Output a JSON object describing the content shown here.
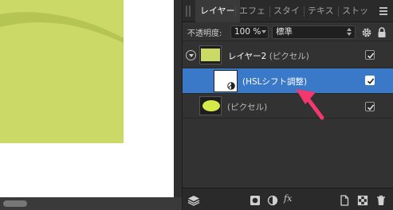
{
  "tabs": [
    {
      "label": "レイヤー",
      "active": true
    },
    {
      "label": "エフェ"
    },
    {
      "label": "スタイ"
    },
    {
      "label": "テキス"
    },
    {
      "label": "ストッ"
    }
  ],
  "opacity": {
    "label": "不透明度:",
    "value": "100 %"
  },
  "blend_mode": {
    "value": "標準"
  },
  "layers": [
    {
      "name": "レイヤー2",
      "type": " (ピクセル)",
      "visible": true,
      "expanded": true
    },
    {
      "name": "(HSLシフト調整)",
      "visible": true,
      "selected": true
    },
    {
      "name": "(ピクセル)",
      "visible": true
    }
  ],
  "icons": {
    "panel_menu": "hamburger-icon",
    "settings": "gear-icon",
    "lock": "lock-icon",
    "bottom": [
      "layers-stack-icon",
      "mask-icon",
      "adjustment-icon",
      "fx-icon",
      "new-document-icon",
      "grid-icon",
      "trash-icon"
    ]
  },
  "bottom_bar": {
    "fx_label": "fx"
  },
  "colors": {
    "selection": "#3a78c8",
    "canvas_art": "#cbd966",
    "ellipse_fill": "#d6ea4a",
    "annotation_arrow": "#f2386c"
  }
}
